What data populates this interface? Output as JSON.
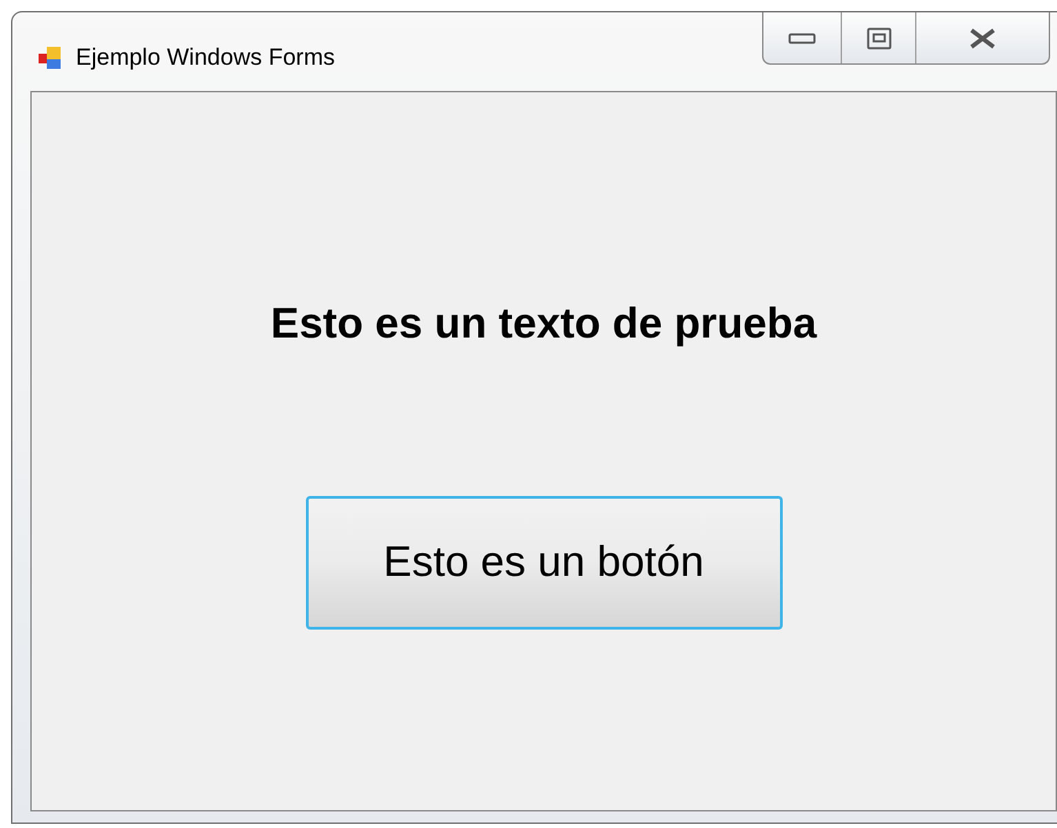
{
  "window": {
    "title": "Ejemplo Windows Forms"
  },
  "label": {
    "text": "Esto es un texto de prueba"
  },
  "button": {
    "label": "Esto es un botón"
  }
}
